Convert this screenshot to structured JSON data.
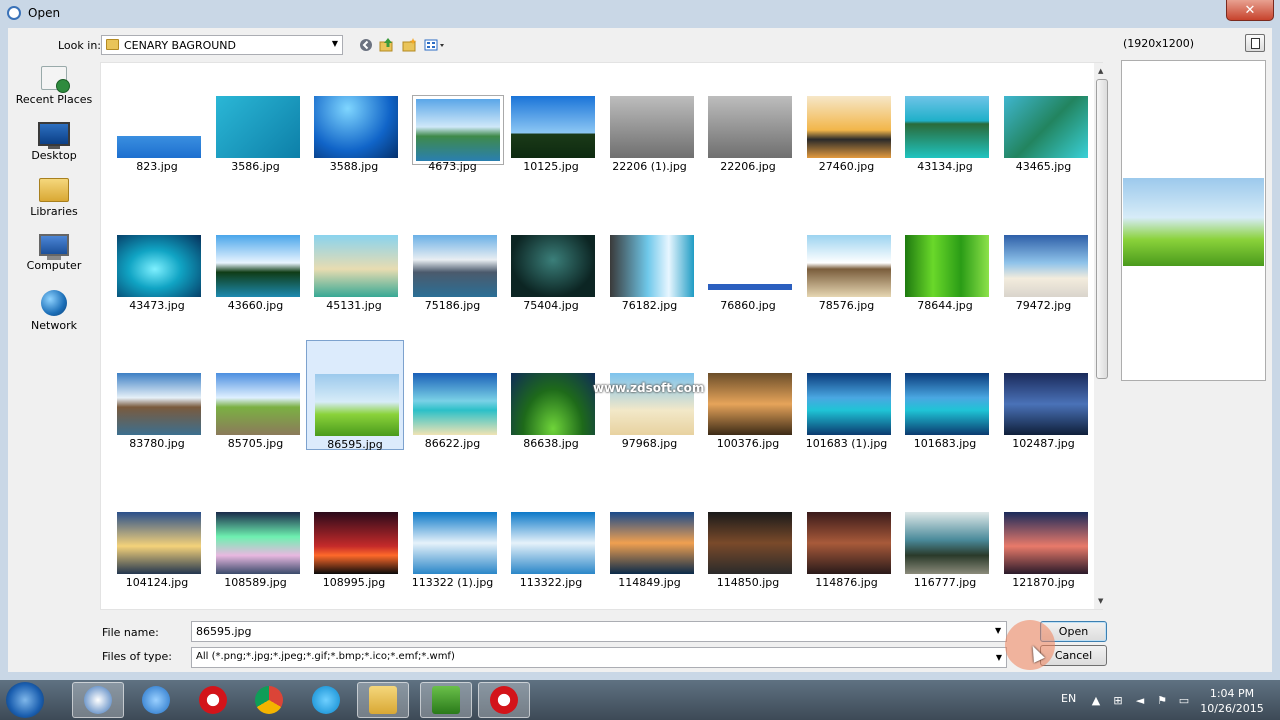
{
  "window": {
    "title": "Open",
    "close_glyph": "✕"
  },
  "toolbar": {
    "look_in_label": "Look in:",
    "look_in_value": "CENARY BAGROUND",
    "icons": [
      "back-icon",
      "up-folder-icon",
      "new-folder-icon",
      "view-menu-icon"
    ]
  },
  "places": [
    {
      "label": "Recent Places",
      "icon": "recent-places-icon"
    },
    {
      "label": "Desktop",
      "icon": "desktop-icon"
    },
    {
      "label": "Libraries",
      "icon": "libraries-icon"
    },
    {
      "label": "Computer",
      "icon": "computer-icon"
    },
    {
      "label": "Network",
      "icon": "network-icon"
    }
  ],
  "files": [
    [
      "823.jpg",
      "3586.jpg",
      "3588.jpg",
      "4673.jpg",
      "10125.jpg",
      "22206 (1).jpg",
      "22206.jpg",
      "27460.jpg",
      "43134.jpg",
      "43465.jpg"
    ],
    [
      "43473.jpg",
      "43660.jpg",
      "45131.jpg",
      "75186.jpg",
      "75404.jpg",
      "76182.jpg",
      "76860.jpg",
      "78576.jpg",
      "78644.jpg",
      "79472.jpg"
    ],
    [
      "83780.jpg",
      "85705.jpg",
      "86595.jpg",
      "86622.jpg",
      "86638.jpg",
      "97968.jpg",
      "100376.jpg",
      "101683 (1).jpg",
      "101683.jpg",
      "102487.jpg"
    ],
    [
      "104124.jpg",
      "108589.jpg",
      "108995.jpg",
      "113322 (1).jpg",
      "113322.jpg",
      "114849.jpg",
      "114850.jpg",
      "114876.jpg",
      "116777.jpg",
      "121870.jpg"
    ]
  ],
  "selected_file": "86595.jpg",
  "watermark": "www.zdsoft.com",
  "preview": {
    "size": "(1920x1200)"
  },
  "form": {
    "file_name_label": "File name:",
    "file_name_value": "86595.jpg",
    "file_type_label": "Files of type:",
    "file_type_value": "All (*.png;*.jpg;*.jpeg;*.gif;*.bmp;*.ico;*.emf;*.wmf)",
    "open_label": "Open",
    "cancel_label": "Cancel"
  },
  "taskbar": {
    "apps": [
      "app-icon-blue",
      "internet-explorer-icon",
      "opera-icon",
      "chrome-icon",
      "skype-icon",
      "file-explorer-icon",
      "camtasia-icon",
      "opera-icon"
    ],
    "language": "EN",
    "time": "1:04 PM",
    "date": "10/26/2015"
  }
}
